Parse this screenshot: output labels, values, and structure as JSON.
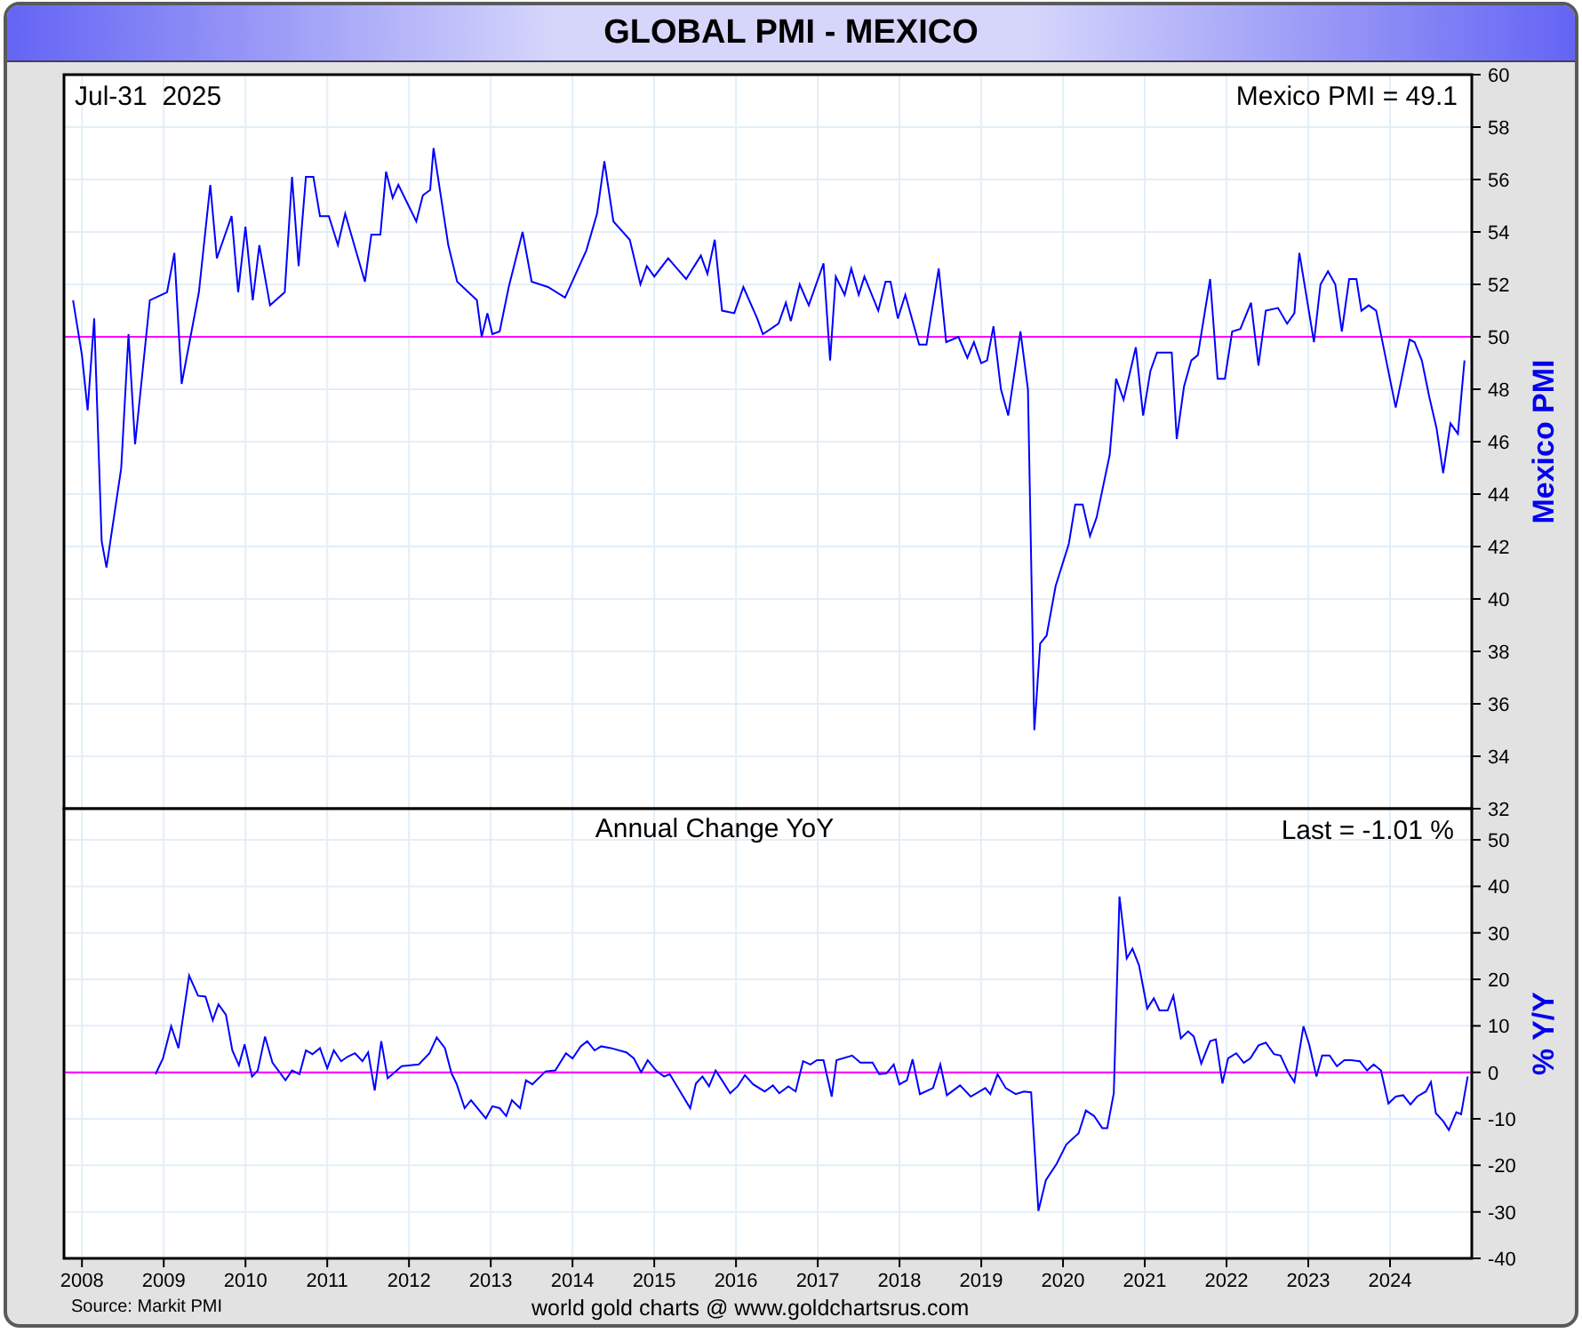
{
  "title": "GLOBAL PMI - MEXICO",
  "top_panel": {
    "date_label": "Jul-31  2025",
    "value_label": "Mexico PMI = 49.1",
    "chart_data": {
      "type": "line",
      "ylabel": "Mexico PMI",
      "grid": true,
      "xlim": [
        2007.78,
        2025.0
      ],
      "ylim": [
        32,
        60
      ],
      "yticks": [
        32,
        34,
        36,
        38,
        40,
        42,
        44,
        46,
        48,
        50,
        52,
        54,
        56,
        58,
        60
      ],
      "ref_lines": [
        {
          "axis": "y",
          "value": 50,
          "color": "#ff00ff"
        }
      ],
      "x": [
        2007.89,
        2008.0,
        2008.07,
        2008.15,
        2008.24,
        2008.3,
        2008.48,
        2008.57,
        2008.65,
        2008.83,
        2009.04,
        2009.13,
        2009.22,
        2009.43,
        2009.57,
        2009.65,
        2009.83,
        2009.91,
        2010.0,
        2010.09,
        2010.17,
        2010.3,
        2010.48,
        2010.57,
        2010.65,
        2010.74,
        2010.83,
        2010.91,
        2011.02,
        2011.13,
        2011.22,
        2011.33,
        2011.46,
        2011.54,
        2011.65,
        2011.72,
        2011.8,
        2011.87,
        2012.09,
        2012.17,
        2012.26,
        2012.3,
        2012.48,
        2012.59,
        2012.83,
        2012.89,
        2012.96,
        2013.02,
        2013.11,
        2013.22,
        2013.39,
        2013.5,
        2013.7,
        2013.91,
        2014.17,
        2014.3,
        2014.39,
        2014.5,
        2014.7,
        2014.83,
        2014.91,
        2015.0,
        2015.17,
        2015.39,
        2015.57,
        2015.65,
        2015.74,
        2015.83,
        2015.98,
        2016.09,
        2016.26,
        2016.33,
        2016.52,
        2016.61,
        2016.67,
        2016.78,
        2016.89,
        2017.07,
        2017.15,
        2017.22,
        2017.33,
        2017.41,
        2017.5,
        2017.57,
        2017.74,
        2017.83,
        2017.89,
        2017.98,
        2018.07,
        2018.24,
        2018.33,
        2018.48,
        2018.57,
        2018.72,
        2018.83,
        2018.91,
        2019.0,
        2019.07,
        2019.15,
        2019.24,
        2019.33,
        2019.48,
        2019.57,
        2019.65,
        2019.72,
        2019.8,
        2019.91,
        2020.07,
        2020.15,
        2020.24,
        2020.33,
        2020.41,
        2020.57,
        2020.65,
        2020.74,
        2020.89,
        2020.98,
        2021.07,
        2021.15,
        2021.33,
        2021.39,
        2021.48,
        2021.57,
        2021.65,
        2021.8,
        2021.89,
        2021.98,
        2022.07,
        2022.17,
        2022.3,
        2022.39,
        2022.48,
        2022.63,
        2022.74,
        2022.83,
        2022.89,
        2023.07,
        2023.15,
        2023.24,
        2023.33,
        2023.41,
        2023.5,
        2023.59,
        2023.65,
        2023.74,
        2023.83,
        2024.07,
        2024.24,
        2024.3,
        2024.39,
        2024.48,
        2024.57,
        2024.65,
        2024.74,
        2024.83,
        2024.91
      ],
      "series": [
        {
          "color": "#0000ff",
          "values": [
            51.4,
            49.3,
            47.2,
            50.7,
            42.2,
            41.2,
            45.0,
            50.1,
            45.9,
            51.4,
            51.7,
            53.2,
            48.2,
            51.7,
            55.8,
            53.0,
            54.6,
            51.7,
            54.2,
            51.4,
            53.5,
            51.2,
            51.7,
            56.1,
            52.7,
            56.1,
            56.1,
            54.6,
            54.6,
            53.5,
            54.7,
            53.5,
            52.1,
            53.9,
            53.9,
            56.3,
            55.3,
            55.8,
            54.4,
            55.4,
            55.6,
            57.2,
            53.5,
            52.1,
            51.4,
            50.0,
            50.9,
            50.1,
            50.2,
            51.9,
            54.0,
            52.1,
            51.9,
            51.5,
            53.3,
            54.7,
            56.7,
            54.4,
            53.7,
            52.0,
            52.7,
            52.3,
            53.0,
            52.2,
            53.1,
            52.4,
            53.7,
            51.0,
            50.9,
            51.9,
            50.7,
            50.1,
            50.5,
            51.3,
            50.6,
            52.0,
            51.2,
            52.8,
            49.1,
            52.3,
            51.6,
            52.6,
            51.6,
            52.3,
            51.0,
            52.1,
            52.1,
            50.7,
            51.6,
            49.7,
            49.7,
            52.6,
            49.8,
            50.0,
            49.2,
            49.8,
            49.0,
            49.1,
            50.4,
            48.0,
            47.0,
            50.2,
            48.0,
            35.0,
            38.3,
            38.6,
            40.5,
            42.1,
            43.6,
            43.6,
            42.4,
            43.1,
            45.5,
            48.4,
            47.6,
            49.6,
            47.0,
            48.7,
            49.4,
            49.4,
            46.1,
            48.1,
            49.1,
            49.3,
            52.2,
            48.4,
            48.4,
            50.2,
            50.3,
            51.3,
            48.9,
            51.0,
            51.1,
            50.5,
            50.9,
            53.2,
            49.8,
            52.0,
            52.5,
            52.0,
            50.2,
            52.2,
            52.2,
            51.0,
            51.2,
            51.0,
            47.3,
            49.9,
            49.8,
            49.1,
            47.7,
            46.5,
            44.8,
            46.7,
            46.3,
            49.1
          ]
        }
      ]
    }
  },
  "bottom_panel": {
    "value_label": "Last = -1.01 %",
    "chart_data": {
      "type": "line",
      "title": "Annual Change YoY",
      "ylabel": "% Y/Y",
      "grid": true,
      "xlim": [
        2007.78,
        2025.0
      ],
      "ylim": [
        -40,
        56.7
      ],
      "xticks": [
        2008,
        2009,
        2010,
        2011,
        2012,
        2013,
        2014,
        2015,
        2016,
        2017,
        2018,
        2019,
        2020,
        2021,
        2022,
        2023,
        2024
      ],
      "yticks": [
        -40,
        -30,
        -20,
        -10,
        0,
        10,
        20,
        30,
        40,
        50
      ],
      "ref_lines": [
        {
          "axis": "y",
          "value": 0,
          "color": "#ff00ff"
        }
      ],
      "x": [
        2008.9,
        2008.99,
        2009.09,
        2009.18,
        2009.31,
        2009.42,
        2009.51,
        2009.6,
        2009.67,
        2009.76,
        2009.84,
        2009.92,
        2009.99,
        2010.08,
        2010.15,
        2010.24,
        2010.33,
        2010.49,
        2010.57,
        2010.66,
        2010.74,
        2010.82,
        2010.91,
        2011.0,
        2011.08,
        2011.17,
        2011.25,
        2011.34,
        2011.43,
        2011.5,
        2011.58,
        2011.66,
        2011.74,
        2011.91,
        2012.12,
        2012.25,
        2012.34,
        2012.44,
        2012.52,
        2012.58,
        2012.68,
        2012.76,
        2012.94,
        2013.02,
        2013.11,
        2013.19,
        2013.26,
        2013.36,
        2013.43,
        2013.51,
        2013.67,
        2013.79,
        2013.92,
        2014.0,
        2014.1,
        2014.18,
        2014.27,
        2014.35,
        2014.47,
        2014.66,
        2014.75,
        2014.84,
        2014.92,
        2015.02,
        2015.12,
        2015.19,
        2015.28,
        2015.44,
        2015.51,
        2015.59,
        2015.67,
        2015.75,
        2015.83,
        2015.93,
        2016.02,
        2016.11,
        2016.21,
        2016.35,
        2016.45,
        2016.53,
        2016.64,
        2016.73,
        2016.82,
        2016.91,
        2016.99,
        2017.07,
        2017.17,
        2017.23,
        2017.42,
        2017.52,
        2017.67,
        2017.75,
        2017.84,
        2017.93,
        2018.0,
        2018.09,
        2018.16,
        2018.25,
        2018.41,
        2018.5,
        2018.58,
        2018.74,
        2018.87,
        2019.05,
        2019.11,
        2019.2,
        2019.3,
        2019.42,
        2019.52,
        2019.61,
        2019.7,
        2019.79,
        2019.92,
        2020.04,
        2020.19,
        2020.28,
        2020.38,
        2020.48,
        2020.54,
        2020.62,
        2020.69,
        2020.78,
        2020.85,
        2020.93,
        2021.03,
        2021.11,
        2021.18,
        2021.28,
        2021.35,
        2021.44,
        2021.53,
        2021.6,
        2021.69,
        2021.8,
        2021.87,
        2021.95,
        2022.02,
        2022.12,
        2022.21,
        2022.29,
        2022.39,
        2022.48,
        2022.58,
        2022.66,
        2022.76,
        2022.83,
        2022.94,
        2023.01,
        2023.1,
        2023.17,
        2023.26,
        2023.35,
        2023.44,
        2023.53,
        2023.63,
        2023.72,
        2023.8,
        2023.89,
        2023.98,
        2024.07,
        2024.16,
        2024.25,
        2024.33,
        2024.44,
        2024.5,
        2024.56,
        2024.65,
        2024.72,
        2024.81,
        2024.87,
        2024.95
      ],
      "series": [
        {
          "color": "#0000ff",
          "values": [
            -0.4,
            3.0,
            9.9,
            5.2,
            20.8,
            16.5,
            16.3,
            11.2,
            14.6,
            12.4,
            4.7,
            1.5,
            6.0,
            -0.9,
            0.4,
            7.7,
            2.1,
            -1.7,
            0.4,
            -0.4,
            4.7,
            3.9,
            5.2,
            0.9,
            4.7,
            2.4,
            3.4,
            4.1,
            2.4,
            4.3,
            -3.9,
            6.7,
            -1.3,
            1.3,
            1.7,
            4.1,
            7.5,
            5.2,
            -0.2,
            -2.4,
            -7.7,
            -6.0,
            -9.9,
            -7.3,
            -7.7,
            -9.4,
            -6.0,
            -7.7,
            -1.7,
            -2.6,
            0.2,
            0.4,
            4.1,
            3.0,
            5.6,
            6.7,
            4.7,
            5.6,
            5.2,
            4.3,
            3.0,
            0.0,
            2.6,
            0.4,
            -0.9,
            -0.4,
            -3.0,
            -7.7,
            -2.4,
            -0.9,
            -3.0,
            0.4,
            -1.7,
            -4.5,
            -3.0,
            -0.6,
            -2.6,
            -4.1,
            -2.8,
            -4.5,
            -3.0,
            -4.1,
            2.4,
            1.7,
            2.6,
            2.6,
            -5.2,
            2.6,
            3.6,
            2.1,
            2.1,
            -0.4,
            -0.2,
            1.7,
            -2.6,
            -1.7,
            2.8,
            -4.7,
            -3.4,
            1.7,
            -4.9,
            -2.8,
            -5.2,
            -3.4,
            -4.7,
            -0.4,
            -3.4,
            -4.7,
            -4.1,
            -4.3,
            -29.8,
            -23.2,
            -19.7,
            -15.5,
            -13.1,
            -8.2,
            -9.4,
            -12.0,
            -12.0,
            -4.5,
            37.8,
            24.5,
            26.6,
            23.0,
            13.7,
            15.9,
            13.3,
            13.3,
            16.5,
            7.3,
            8.8,
            7.7,
            1.9,
            6.7,
            7.1,
            -2.4,
            3.0,
            4.1,
            2.1,
            3.0,
            5.8,
            6.4,
            3.9,
            3.6,
            -0.2,
            -2.1,
            9.9,
            6.0,
            -0.9,
            3.6,
            3.6,
            1.3,
            2.6,
            2.6,
            2.4,
            0.4,
            1.7,
            0.4,
            -6.7,
            -5.2,
            -4.9,
            -6.9,
            -5.2,
            -4.1,
            -2.1,
            -8.8,
            -10.5,
            -12.4,
            -8.6,
            -9.0,
            -0.9
          ]
        }
      ]
    }
  },
  "footer": {
    "source": "Source: Markit PMI",
    "credit": "world gold charts @ www.goldchartsrus.com"
  }
}
